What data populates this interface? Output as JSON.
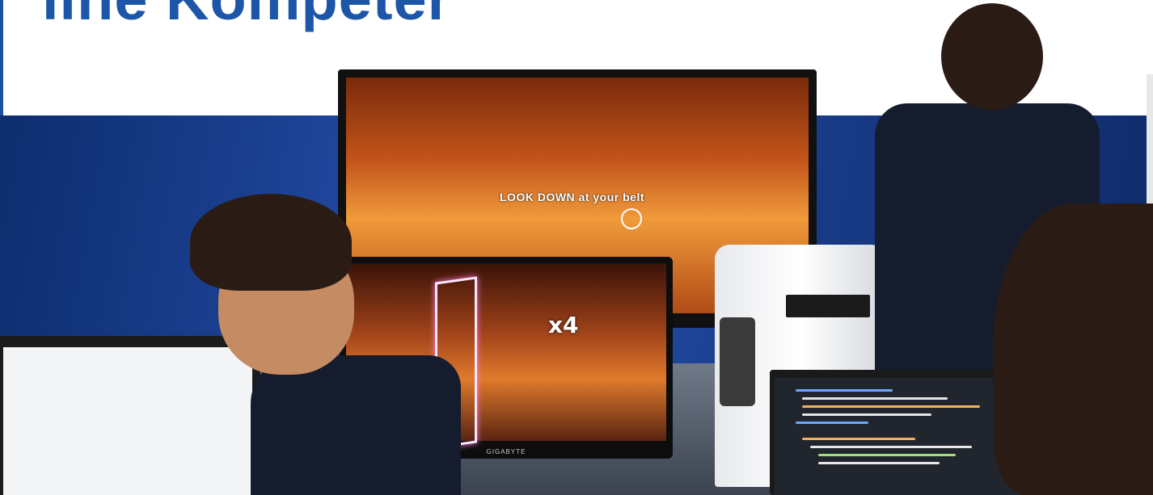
{
  "headline": "iine Kompeter",
  "game_prompt": "LOOK DOWN at your belt",
  "combo_counter": "x4",
  "monitor_brand": "GIGABYTE",
  "colors": {
    "headline_blue": "#1d56a8",
    "banner_blue": "#1a3f8f",
    "accent_yellow": "#d8db3c"
  }
}
